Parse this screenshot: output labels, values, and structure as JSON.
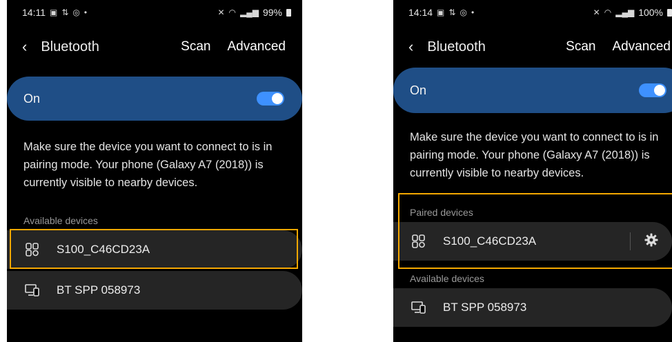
{
  "colors": {
    "accent": "#3e91ff",
    "on_card": "#1f4e86",
    "highlight": "#f5a800"
  },
  "left": {
    "status": {
      "time": "14:11",
      "battery": "99%"
    },
    "header": {
      "title": "Bluetooth",
      "scan": "Scan",
      "advanced": "Advanced"
    },
    "toggle": {
      "label": "On",
      "state": "on"
    },
    "info": "Make sure the device you want to connect to is in pairing mode. Your phone (Galaxy A7 (2018)) is currently visible to nearby devices.",
    "available_label": "Available devices",
    "devices": [
      {
        "name": "S100_C46CD23A",
        "icon": "keypad-device-icon"
      },
      {
        "name": "BT SPP 058973",
        "icon": "monitor-phone-icon"
      }
    ]
  },
  "right": {
    "status": {
      "time": "14:14",
      "battery": "100%"
    },
    "header": {
      "title": "Bluetooth",
      "scan": "Scan",
      "advanced": "Advanced"
    },
    "toggle": {
      "label": "On",
      "state": "on"
    },
    "info": "Make sure the device you want to connect to is in pairing mode. Your phone (Galaxy A7 (2018)) is currently visible to nearby devices.",
    "paired_label": "Paired devices",
    "paired": [
      {
        "name": "S100_C46CD23A",
        "icon": "keypad-device-icon"
      }
    ],
    "available_label": "Available devices",
    "devices": [
      {
        "name": "BT SPP 058973",
        "icon": "monitor-phone-icon"
      }
    ]
  }
}
